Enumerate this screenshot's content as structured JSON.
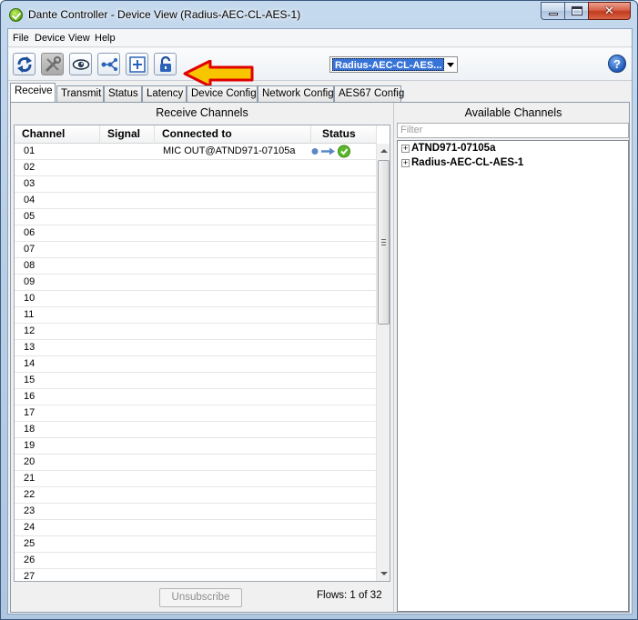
{
  "window": {
    "title": "Dante Controller - Device View (Radius-AEC-CL-AES-1)",
    "icon": "dante-app-icon"
  },
  "menu": {
    "items": [
      "File",
      "Device",
      "View",
      "Help"
    ]
  },
  "toolbar": {
    "buttons": [
      {
        "name": "refresh-icon"
      },
      {
        "name": "tools-icon",
        "disabled": true
      },
      {
        "name": "eye-icon"
      },
      {
        "name": "network-icon"
      },
      {
        "name": "add-icon"
      },
      {
        "name": "lock-icon"
      }
    ],
    "device_selected": "Radius-AEC-CL-AES...",
    "help_label": "?",
    "annotation_arrow_color": "#f7c600"
  },
  "tabs": [
    "Receive",
    "Transmit",
    "Status",
    "Latency",
    "Device Config",
    "Network Config",
    "AES67 Config"
  ],
  "receive": {
    "title": "Receive Channels",
    "columns": [
      "Channel",
      "Signal",
      "Connected to",
      "Status"
    ],
    "rows": [
      {
        "channel": "01",
        "connected_to": "MIC OUT@ATND971-07105a",
        "status": "ok"
      },
      {
        "channel": "02"
      },
      {
        "channel": "03"
      },
      {
        "channel": "04"
      },
      {
        "channel": "05"
      },
      {
        "channel": "06"
      },
      {
        "channel": "07"
      },
      {
        "channel": "08"
      },
      {
        "channel": "09"
      },
      {
        "channel": "10"
      },
      {
        "channel": "11"
      },
      {
        "channel": "12"
      },
      {
        "channel": "13"
      },
      {
        "channel": "14"
      },
      {
        "channel": "15"
      },
      {
        "channel": "16"
      },
      {
        "channel": "17"
      },
      {
        "channel": "18"
      },
      {
        "channel": "19"
      },
      {
        "channel": "20"
      },
      {
        "channel": "21"
      },
      {
        "channel": "22"
      },
      {
        "channel": "23"
      },
      {
        "channel": "24"
      },
      {
        "channel": "25"
      },
      {
        "channel": "26"
      },
      {
        "channel": "27"
      }
    ],
    "unsubscribe_label": "Unsubscribe",
    "flows": "Flows: 1 of 32"
  },
  "available": {
    "title": "Available Channels",
    "filter_placeholder": "Filter",
    "devices": [
      "ATND971-07105a",
      "Radius-AEC-CL-AES-1"
    ]
  },
  "colors": {
    "status_ok": "#5bb82a",
    "status_dot": "#5b87c8"
  }
}
